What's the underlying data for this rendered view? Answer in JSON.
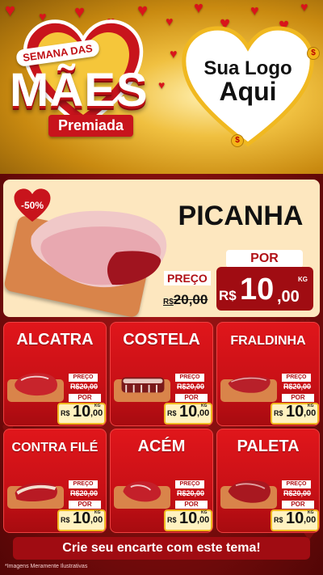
{
  "header": {
    "semana_label": "SEMANA DAS",
    "maes_label": "MÃES",
    "premiada_label": "Premiada",
    "logo_line1": "Sua Logo",
    "logo_line2": "Aqui"
  },
  "feature": {
    "discount": "-50%",
    "name": "PICANHA",
    "preco_label": "PREÇO",
    "old_currency": "R$",
    "old_price": "20,00",
    "por_label": "POR",
    "currency": "R$",
    "price_int": "10",
    "price_dec": ",00",
    "unit": "KG"
  },
  "cards": [
    {
      "name": "ALCATRA",
      "preco_label": "PREÇO",
      "old_price": "R$20,00",
      "por_label": "POR",
      "currency": "R$",
      "price_int": "10",
      "price_dec": ",00",
      "unit": "KG"
    },
    {
      "name": "COSTELA",
      "preco_label": "PREÇO",
      "old_price": "R$20,00",
      "por_label": "POR",
      "currency": "R$",
      "price_int": "10",
      "price_dec": ",00",
      "unit": "KG"
    },
    {
      "name": "FRALDINHA",
      "preco_label": "PREÇO",
      "old_price": "R$20,00",
      "por_label": "POR",
      "currency": "R$",
      "price_int": "10",
      "price_dec": ",00",
      "unit": "KG"
    },
    {
      "name": "CONTRA FILÉ",
      "preco_label": "PREÇO",
      "old_price": "R$20,00",
      "por_label": "POR",
      "currency": "R$",
      "price_int": "10",
      "price_dec": ",00",
      "unit": "KG"
    },
    {
      "name": "ACÉM",
      "preco_label": "PREÇO",
      "old_price": "R$20,00",
      "por_label": "POR",
      "currency": "R$",
      "price_int": "10",
      "price_dec": ",00",
      "unit": "KG"
    },
    {
      "name": "PALETA",
      "preco_label": "PREÇO",
      "old_price": "R$20,00",
      "por_label": "POR",
      "currency": "R$",
      "price_int": "10",
      "price_dec": ",00",
      "unit": "KG"
    }
  ],
  "cta_label": "Crie seu encarte com este tema!",
  "disclaimer": "*Imagens Meramente Ilustrativas",
  "colors": {
    "primary_red": "#d9141b",
    "dark_red": "#a00c12",
    "cream": "#fde7bf",
    "gold": "#f0c040"
  }
}
